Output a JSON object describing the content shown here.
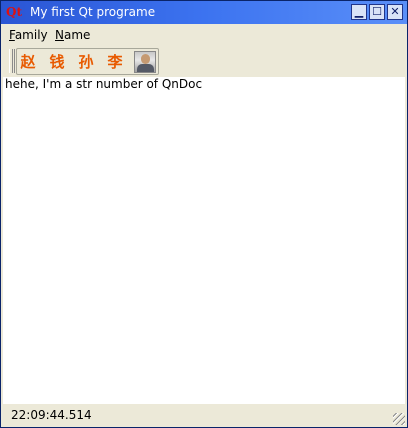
{
  "window": {
    "app_icon_text": "Qt",
    "title": "My first Qt programe",
    "controls": {
      "minimize": "▁",
      "maximize": "☐",
      "close": "✕"
    }
  },
  "menubar": {
    "items": [
      {
        "label_mnemonic": "F",
        "label_rest": "amily"
      },
      {
        "label_mnemonic": "N",
        "label_rest": "ame"
      }
    ]
  },
  "toolbar": {
    "buttons": [
      "赵",
      "钱",
      "孙",
      "李"
    ],
    "avatar_icon": "person-photo-icon"
  },
  "document": {
    "text": "hehe, I'm a str number of QnDoc"
  },
  "statusbar": {
    "time": "22:09:44.514"
  }
}
